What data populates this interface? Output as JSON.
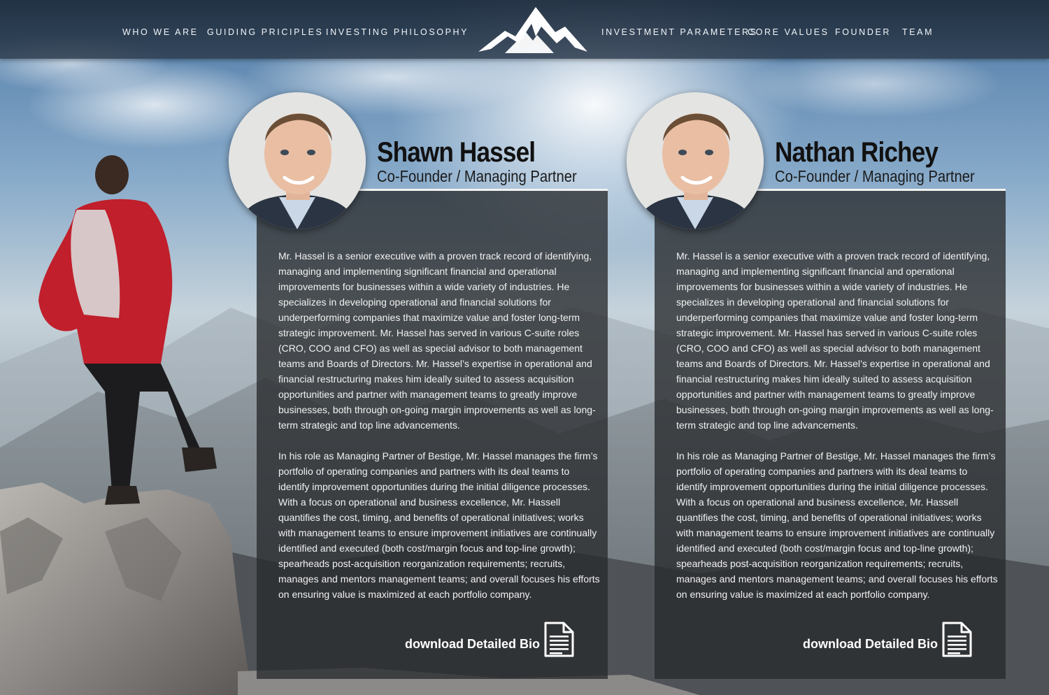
{
  "nav": {
    "left": [
      "WHO WE ARE",
      "GUIDING PRICIPLES",
      "INVESTING PHILOSOPHY"
    ],
    "right": [
      "INVESTMENT PARAMETERS",
      "CORE VALUES",
      "FOUNDER",
      "TEAM"
    ]
  },
  "logo": {
    "icon": "mountain-logo-icon"
  },
  "team": [
    {
      "name": "Shawn Hassel",
      "title": "Co-Founder / Managing Partner",
      "bio_p1": "Mr. Hassel is a senior executive with a proven track record of identifying, managing and implementing significant financial and operational improvements for businesses within a wide variety of industries. He specializes in developing operational and financial solutions for underperforming companies that maximize value and foster long-term strategic improvement.  Mr. Hassel has served in various C-suite roles (CRO, COO and CFO) as well as special advisor to both management teams and Boards of Directors.  Mr. Hassel’s expertise in operational and financial restructuring makes him ideally suited to assess acquisition opportunities and partner with management teams to greatly improve businesses, both through on-going margin improvements as well as long-term strategic and top line advancements.",
      "bio_p2": "In his role as Managing Partner of Bestige, Mr. Hassel manages the firm’s portfolio of operating companies and partners with its deal teams to identify improvement opportunities during the initial diligence processes. With a focus on operational and business excellence, Mr. Hassell quantifies the cost, timing, and benefits of operational initiatives; works with management teams to ensure improvement initiatives are continually identified and executed (both cost/margin focus and top-line growth); spearheads post-acquisition reorganization requirements; recruits, manages and mentors management teams; and overall focuses his efforts on ensuring value is maximized at each portfolio company.",
      "download_label": "download Detailed Bio"
    },
    {
      "name": "Nathan Richey",
      "title": "Co-Founder / Managing Partner",
      "bio_p1": "Mr. Hassel is a senior executive with a proven track record of identifying, managing and implementing significant financial and operational improvements for businesses within a wide variety of industries. He specializes in developing operational and financial solutions for underperforming companies that maximize value and foster long-term strategic improvement.  Mr. Hassel has served in various C-suite roles (CRO, COO and CFO) as well as special advisor to both management teams and Boards of Directors.  Mr. Hassel’s expertise in operational and financial restructuring makes him ideally suited to assess acquisition opportunities and partner with management teams to greatly improve businesses, both through on-going margin improvements as well as long-term strategic and top line advancements.",
      "bio_p2": "In his role as Managing Partner of Bestige, Mr. Hassel manages the firm’s portfolio of operating companies and partners with its deal teams to identify improvement opportunities during the initial diligence processes. With a focus on operational and business excellence, Mr. Hassell quantifies the cost, timing, and benefits of operational initiatives; works with management teams to ensure improvement initiatives are continually identified and executed (both cost/margin focus and top-line growth); spearheads post-acquisition reorganization requirements; recruits, manages and mentors management teams; and overall focuses his efforts on ensuring value is maximized at each portfolio company.",
      "download_label": "download Detailed Bio"
    }
  ],
  "icons": {
    "download": "document-icon",
    "portrait": "portrait-photo",
    "hiker": "hiker-photo"
  },
  "colors": {
    "nav_bg": "#2a3a4c",
    "card_bg": "#2d2f32",
    "text_light": "#f1f1f1",
    "name_text": "#111111"
  }
}
